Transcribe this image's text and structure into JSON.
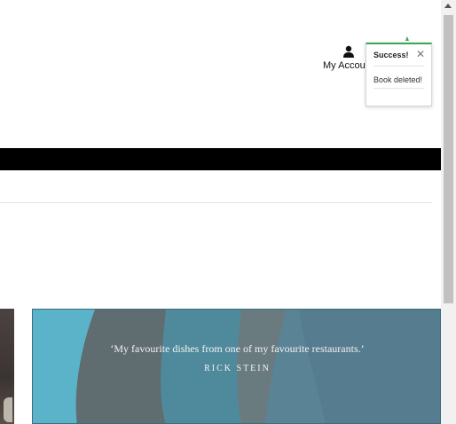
{
  "header": {
    "account_label": "My Account",
    "account_icon": "user-icon"
  },
  "toast": {
    "title": "Success!",
    "close_symbol": "✕",
    "message": "Book deleted!",
    "accent_color": "#3aa655"
  },
  "carousel": {
    "quote": "‘My favourite dishes from one of my favourite restaurants.’",
    "author": "RICK STEIN"
  }
}
